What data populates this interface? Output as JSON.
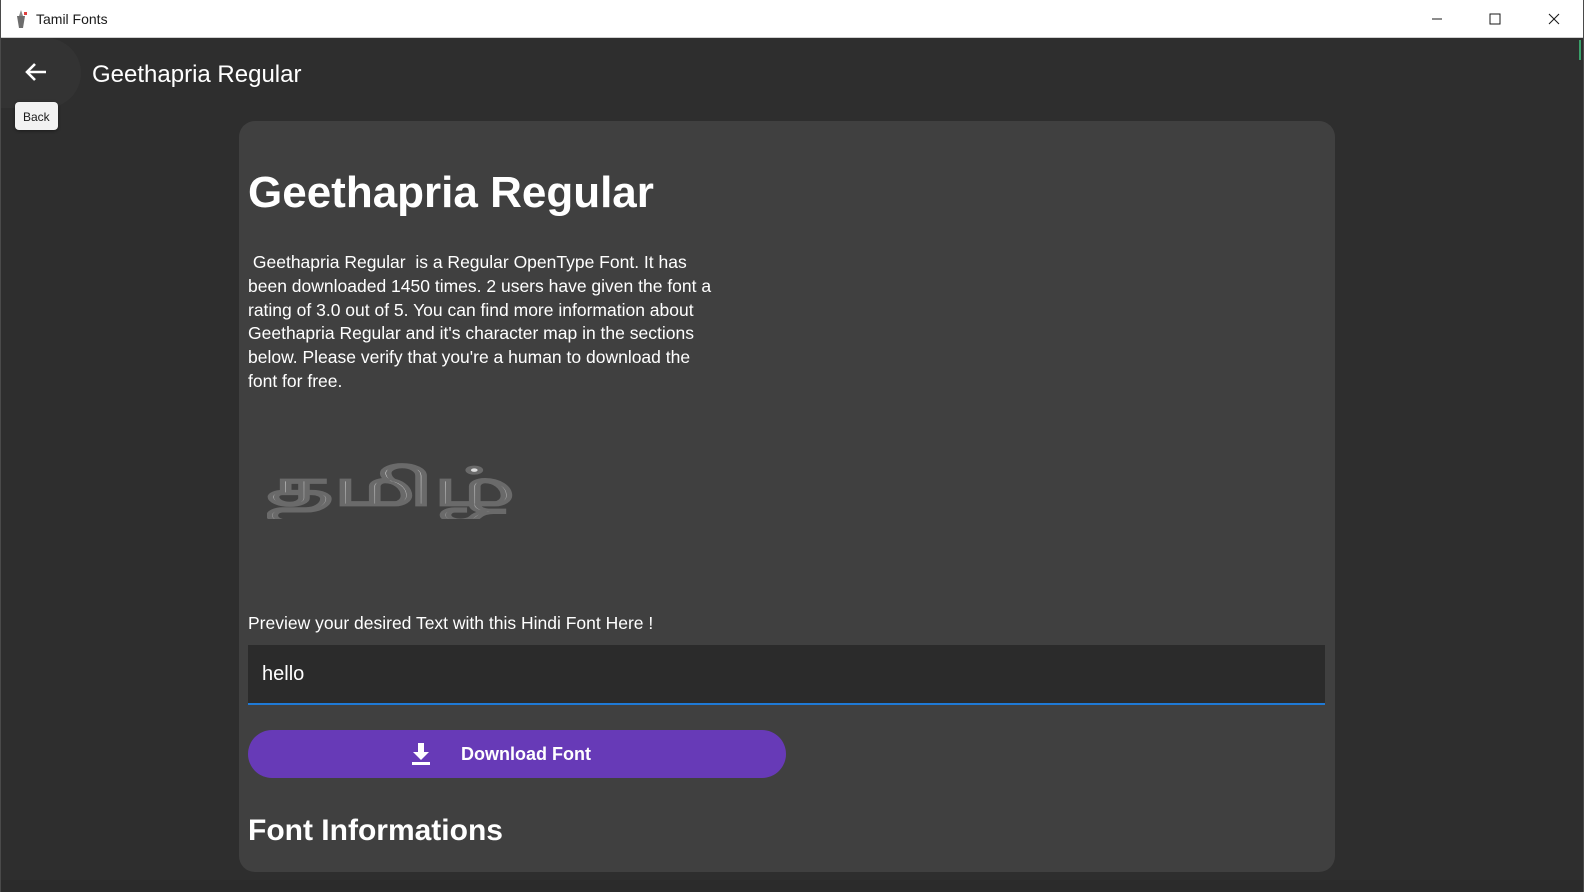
{
  "window": {
    "title": "Tamil Fonts",
    "controls": {
      "minimize": "minimize-icon",
      "maximize": "maximize-icon",
      "close": "close-icon"
    }
  },
  "header": {
    "back_icon": "arrow-left-icon",
    "back_tooltip": "Back",
    "title": "Geethapria Regular"
  },
  "main": {
    "font_name": "Geethapria Regular",
    "description": " Geethapria Regular  is a Regular OpenType Font. It has been downloaded 1450 times. 2 users have given the font a rating of 3.0 out of 5. You can find more information about Geethapria Regular and it's character map in the sections below. Please verify that you're a human to download the font for free.",
    "preview_image_text": "தமிழ்",
    "preview_label": "Preview your desired Text with this Hindi Font Here !",
    "preview_input_value": "hello",
    "download_label": "Download Font",
    "download_icon": "download-icon",
    "info_heading": "Font Informations"
  },
  "colors": {
    "background": "#2e2e2e",
    "card": "#404040",
    "accent_button": "#673ab7",
    "input_underline": "#1f7ad6"
  }
}
